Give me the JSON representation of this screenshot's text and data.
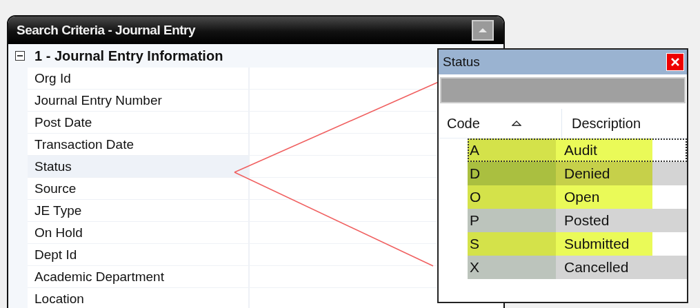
{
  "panel": {
    "title": "Search Criteria - Journal Entry",
    "section": {
      "title": "1 - Journal Entry Information",
      "expanded": true
    },
    "fields": [
      {
        "label": "Org Id",
        "selected": false
      },
      {
        "label": "Journal Entry Number",
        "selected": false
      },
      {
        "label": "Post Date",
        "selected": false
      },
      {
        "label": "Transaction Date",
        "selected": false
      },
      {
        "label": "Status",
        "selected": true
      },
      {
        "label": "Source",
        "selected": false
      },
      {
        "label": "JE Type",
        "selected": false
      },
      {
        "label": "On Hold",
        "selected": false
      },
      {
        "label": "Dept Id",
        "selected": false
      },
      {
        "label": "Academic Department",
        "selected": false
      },
      {
        "label": "Location",
        "selected": false
      }
    ]
  },
  "popup": {
    "title": "Status",
    "columns": [
      {
        "label": "Code",
        "sorted": true
      },
      {
        "label": "Description",
        "sorted": false
      }
    ],
    "rows": [
      {
        "code": "A",
        "description": "Audit",
        "highlighted": true,
        "focused": true
      },
      {
        "code": "D",
        "description": "Denied",
        "highlighted": true,
        "focused": false
      },
      {
        "code": "O",
        "description": "Open",
        "highlighted": true,
        "focused": false
      },
      {
        "code": "P",
        "description": "Posted",
        "highlighted": false,
        "focused": false
      },
      {
        "code": "S",
        "description": "Submitted",
        "highlighted": true,
        "focused": false
      },
      {
        "code": "X",
        "description": "Cancelled",
        "highlighted": false,
        "focused": false
      }
    ]
  }
}
